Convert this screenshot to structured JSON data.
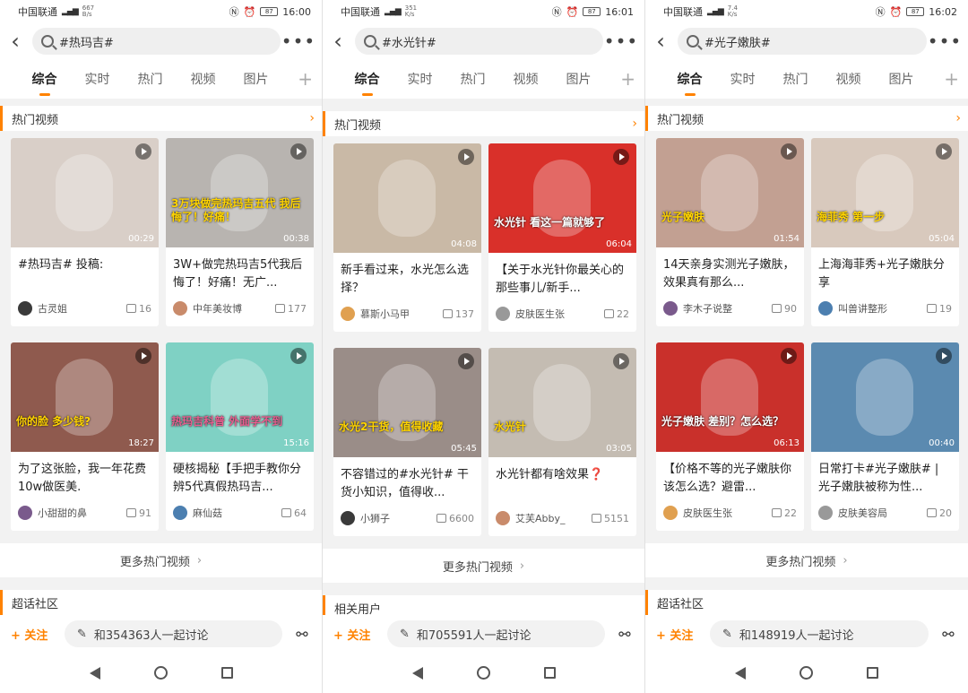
{
  "panels": [
    {
      "status": {
        "carrier": "中国联通",
        "speed": "667 B/s",
        "time": "16:00"
      },
      "search": "#热玛吉#",
      "tabs": [
        "综合",
        "实时",
        "热门",
        "视频",
        "图片"
      ],
      "section_title": "热门视频",
      "cards": [
        {
          "title": "#热玛吉# 投稿:",
          "author": "古灵姐",
          "likes": "16",
          "duration": "00:29",
          "overlay": "",
          "color": "#d9cfc8"
        },
        {
          "title": "3W+做完热玛吉5代我后悔了！好痛！无广...",
          "author": "中年美妆博",
          "likes": "177",
          "duration": "00:38",
          "overlay": "3万块做完热玛吉五代 我后悔了！好痛！",
          "color": "#b8b4b0"
        },
        {
          "title": "为了这张脸，我一年花费10w做医美.",
          "author": "小甜甜的鼻",
          "likes": "91",
          "duration": "18:27",
          "overlay": "你的脸 多少钱?",
          "color": "#8f5a4e"
        },
        {
          "title": "硬核揭秘【手把手教你分辨5代真假热玛吉...",
          "author": "麻仙菇",
          "likes": "64",
          "duration": "15:16",
          "overlay": "热玛吉科普 外面学不到",
          "color": "#7fd1c4"
        }
      ],
      "more_label": "更多热门视频",
      "next_section": "超话社区",
      "follow": "+ 关注",
      "discuss": "和354363人一起讨论"
    },
    {
      "status": {
        "carrier": "中国联通",
        "speed": "351 K/s",
        "time": "16:01"
      },
      "search": "#水光针#",
      "tabs": [
        "综合",
        "实时",
        "热门",
        "视频",
        "图片"
      ],
      "section_title": "热门视频",
      "cards": [
        {
          "title": "新手看过来，水光怎么选择？",
          "author": "慕斯小马甲",
          "likes": "137",
          "duration": "04:08",
          "overlay": "",
          "color": "#c9b9a6"
        },
        {
          "title": "【关于水光针你最关心的那些事儿/新手...",
          "author": "皮肤医生张",
          "likes": "22",
          "duration": "06:04",
          "overlay": "水光针 看这一篇就够了",
          "color": "#d9302a"
        },
        {
          "title": "不容错过的#水光针# 干货小知识，值得收...",
          "author": "小狮子",
          "likes": "6600",
          "duration": "05:45",
          "overlay": "水光2干货，值得收藏",
          "color": "#9a8d88"
        },
        {
          "title": "水光针都有啥效果❓",
          "author": "艾芙Abby_",
          "likes": "5151",
          "duration": "03:05",
          "overlay": "水光针",
          "color": "#c4bcb2"
        }
      ],
      "more_label": "更多热门视频",
      "next_section": "相关用户",
      "follow": "+ 关注",
      "discuss": "和705591人一起讨论"
    },
    {
      "status": {
        "carrier": "中国联通",
        "speed": "7.4 K/s",
        "time": "16:02"
      },
      "search": "#光子嫩肤#",
      "tabs": [
        "综合",
        "实时",
        "热门",
        "视频",
        "图片"
      ],
      "section_title": "热门视频",
      "cards": [
        {
          "title": "14天亲身实测光子嫩肤，效果真有那么...",
          "author": "李木子说整",
          "likes": "90",
          "duration": "01:54",
          "overlay": "光子嫩肤",
          "color": "#c2a092"
        },
        {
          "title": "上海海菲秀+光子嫩肤分享",
          "author": "叫兽讲整形",
          "likes": "19",
          "duration": "05:04",
          "overlay": "海菲秀 第一步",
          "color": "#d8c9bd"
        },
        {
          "title": "【价格不等的光子嫩肤你该怎么选？避雷...",
          "author": "皮肤医生张",
          "likes": "22",
          "duration": "06:13",
          "overlay": "光子嫩肤 差别？怎么选？",
          "color": "#c9302b"
        },
        {
          "title": "日常打卡#光子嫩肤# | 光子嫩肤被称为性...",
          "author": "皮肤美容局",
          "likes": "20",
          "duration": "00:40",
          "overlay": "",
          "color": "#5b8ab0"
        }
      ],
      "more_label": "更多热门视频",
      "next_section": "超话社区",
      "follow": "+ 关注",
      "discuss": "和148919人一起讨论"
    }
  ]
}
